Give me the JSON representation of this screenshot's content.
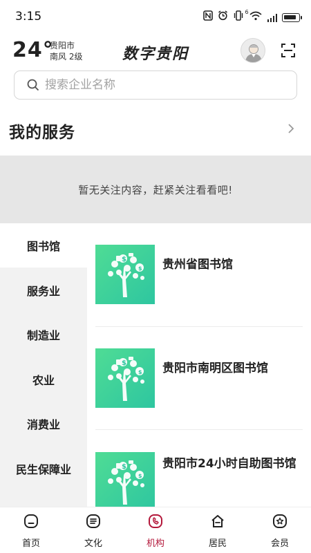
{
  "status_bar": {
    "time": "3:15",
    "network_label": "6"
  },
  "header": {
    "temperature": "24°",
    "city": "贵阳市",
    "wind": "南风  2级",
    "title": "数字贵阳"
  },
  "search": {
    "placeholder": "搜索企业名称"
  },
  "services": {
    "title": "我的服务",
    "empty_message": "暂无关注内容，赶紧关注看看吧!"
  },
  "categories": [
    {
      "label": "图书馆",
      "active": true
    },
    {
      "label": "服务业",
      "active": false
    },
    {
      "label": "制造业",
      "active": false
    },
    {
      "label": "农业",
      "active": false
    },
    {
      "label": "消费业",
      "active": false
    },
    {
      "label": "民生保障业",
      "active": false
    }
  ],
  "libraries": [
    {
      "name": "贵州省图书馆"
    },
    {
      "name": "贵阳市南明区图书馆"
    },
    {
      "name": "贵阳市24小时自助图书馆"
    }
  ],
  "bottom_nav": [
    {
      "label": "首页",
      "icon": "home-icon",
      "active": false
    },
    {
      "label": "文化",
      "icon": "culture-icon",
      "active": false
    },
    {
      "label": "机构",
      "icon": "institution-icon",
      "active": true
    },
    {
      "label": "居民",
      "icon": "resident-icon",
      "active": false
    },
    {
      "label": "会员",
      "icon": "member-icon",
      "active": false
    }
  ],
  "colors": {
    "accent": "#b3173a",
    "thumb_green": "#3fd39a",
    "empty_bg": "#e6e6e6"
  }
}
